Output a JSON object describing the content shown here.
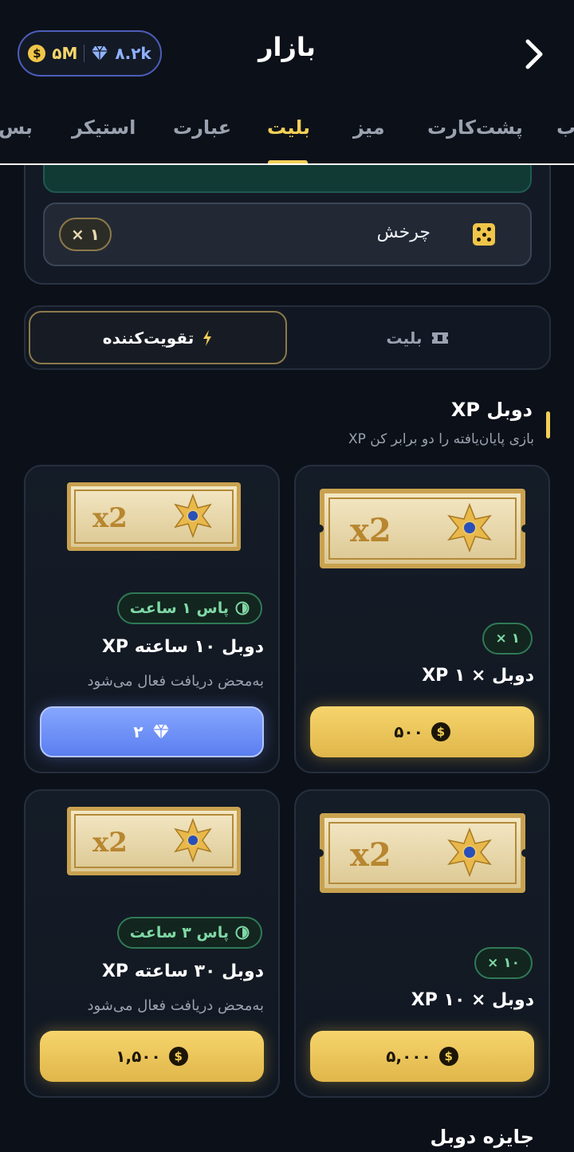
{
  "header": {
    "title": "بازار",
    "coins": "۵M",
    "gems": "۸.۲k",
    "coin_symbol": "$"
  },
  "tabs": [
    {
      "label": "ب"
    },
    {
      "label": "پشت‌کارت"
    },
    {
      "label": "میز"
    },
    {
      "label": "بلیت",
      "active": true
    },
    {
      "label": "عبارت"
    },
    {
      "label": "استیکر"
    },
    {
      "label": "بس"
    }
  ],
  "top_card": {
    "spin_label": "چرخش",
    "spin_multiplier": "× ۱"
  },
  "toggle": {
    "active_label": "تقویت‌کننده",
    "inactive_label": "بلیت"
  },
  "section": {
    "title": "XP دوبل",
    "subtitle": "XP بازی پایان‌یافته را دو برابر کن",
    "next_title": "جایزه دوبل"
  },
  "cards": [
    {
      "badge": "× ۱",
      "title": "XP دوبل × ۱",
      "price": "۵۰۰",
      "currency": "coin"
    },
    {
      "badge": "پاس ۱ ساعت",
      "title": "XP دوبل ۱۰ ساعته",
      "desc": "به‌محض دریافت فعال می‌شود",
      "price": "۲",
      "currency": "gem"
    },
    {
      "badge": "× ۱۰",
      "title": "XP دوبل × ۱۰",
      "price": "۵,۰۰۰",
      "currency": "coin"
    },
    {
      "badge": "پاس ۳ ساعت",
      "title": "XP دوبل ۳۰ ساعته",
      "desc": "به‌محض دریافت فعال می‌شود",
      "price": "۱,۵۰۰",
      "currency": "coin"
    }
  ],
  "colors": {
    "accent_gold": "#f4cf58",
    "accent_blue": "#5a7ef0",
    "badge_green": "#7fd8a6",
    "background": "#0c1119"
  }
}
